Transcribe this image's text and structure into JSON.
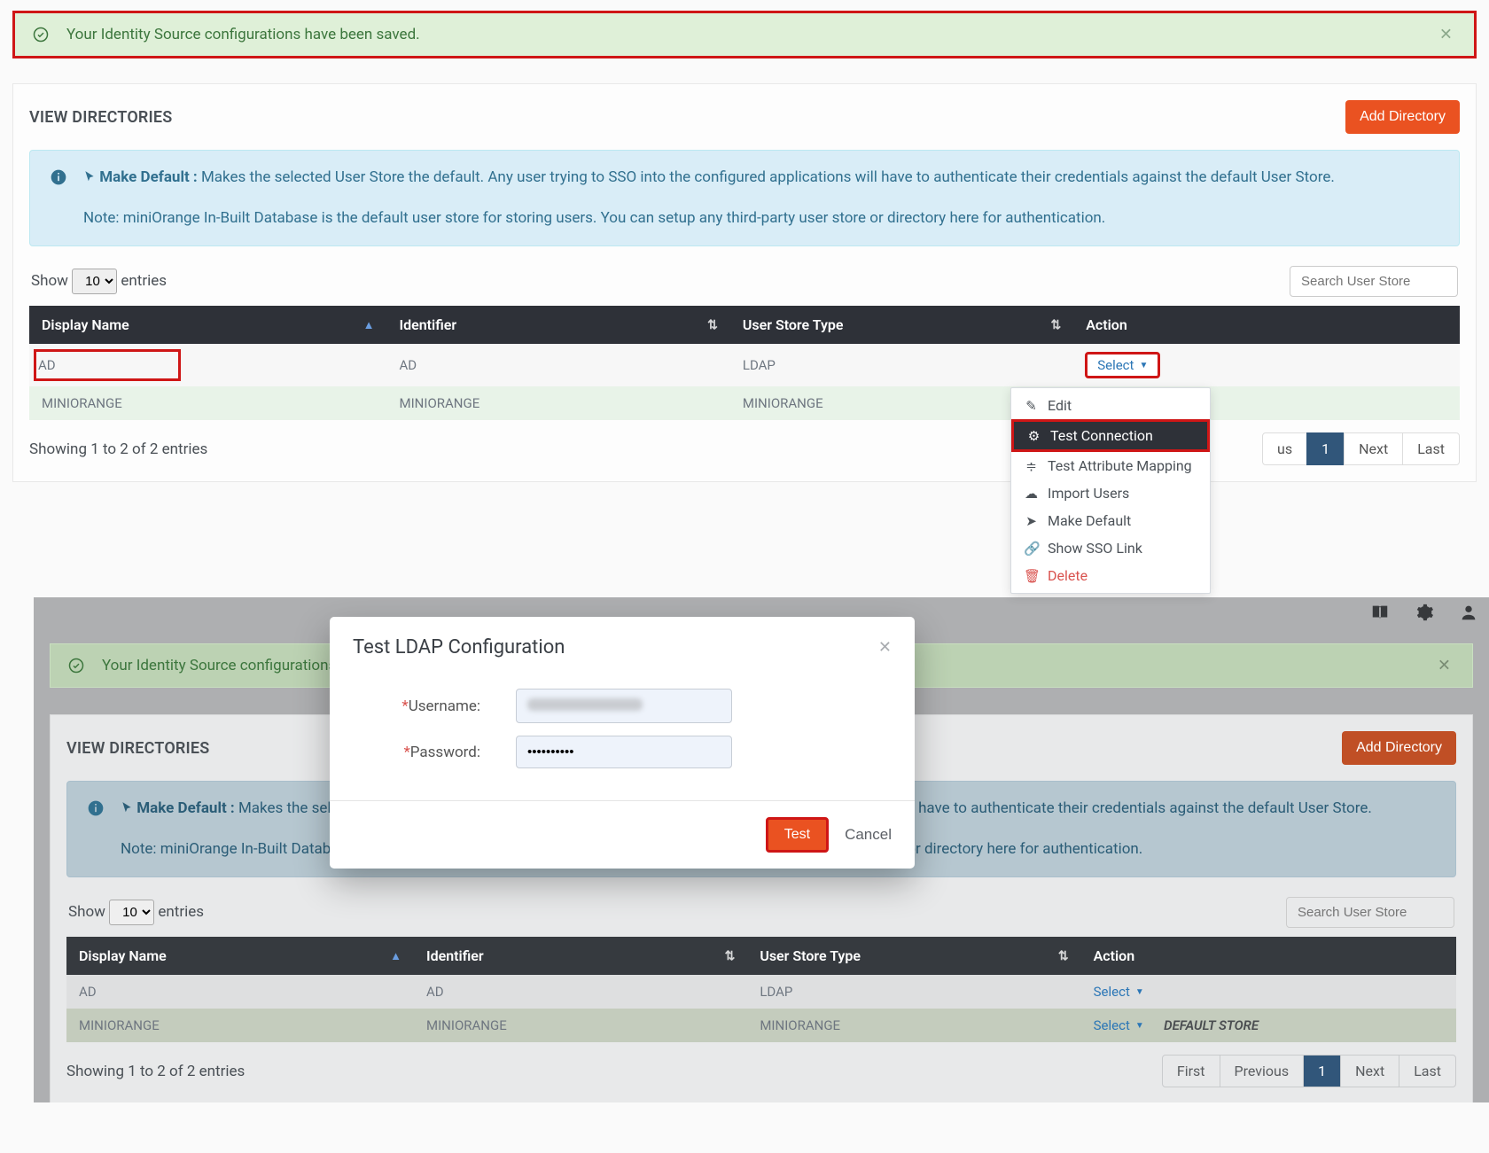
{
  "alert": {
    "text": "Your Identity Source configurations have been saved."
  },
  "card": {
    "title": "VIEW DIRECTORIES",
    "add_btn": "Add Directory"
  },
  "info": {
    "mkdef_label": "Make Default :",
    "mkdef_text": "Makes the selected User Store the default. Any user trying to SSO into the configured applications will have to authenticate their credentials against the default User Store.",
    "note": "Note: miniOrange In-Built Database is the default user store for storing users. You can setup any third-party user store or directory here for authentication."
  },
  "table": {
    "show_pre": "Show",
    "show_val": "10",
    "show_post": "entries",
    "search_ph": "Search User Store",
    "cols": {
      "name": "Display Name",
      "ident": "Identifier",
      "type": "User Store Type",
      "action": "Action"
    },
    "rows": [
      {
        "name": "AD",
        "ident": "AD",
        "type": "LDAP"
      },
      {
        "name": "MINIORANGE",
        "ident": "MINIORANGE",
        "type": "MINIORANGE"
      }
    ],
    "select_label": "Select",
    "foot": "Showing 1 to 2 of 2 entries",
    "paging": {
      "first": "First",
      "prev": "Previous",
      "page": "1",
      "next": "Next",
      "last": "Last"
    }
  },
  "dropdown": {
    "edit": "Edit",
    "test_conn": "Test Connection",
    "test_attr": "Test Attribute Mapping",
    "import": "Import Users",
    "mkdef": "Make Default",
    "sso": "Show SSO Link",
    "delete": "Delete"
  },
  "modal": {
    "title": "Test LDAP Configuration",
    "user_label": "Username:",
    "pass_label": "Password:",
    "pass_val": "••••••••••",
    "test": "Test",
    "cancel": "Cancel"
  },
  "default_store": "DEFAULT STORE"
}
